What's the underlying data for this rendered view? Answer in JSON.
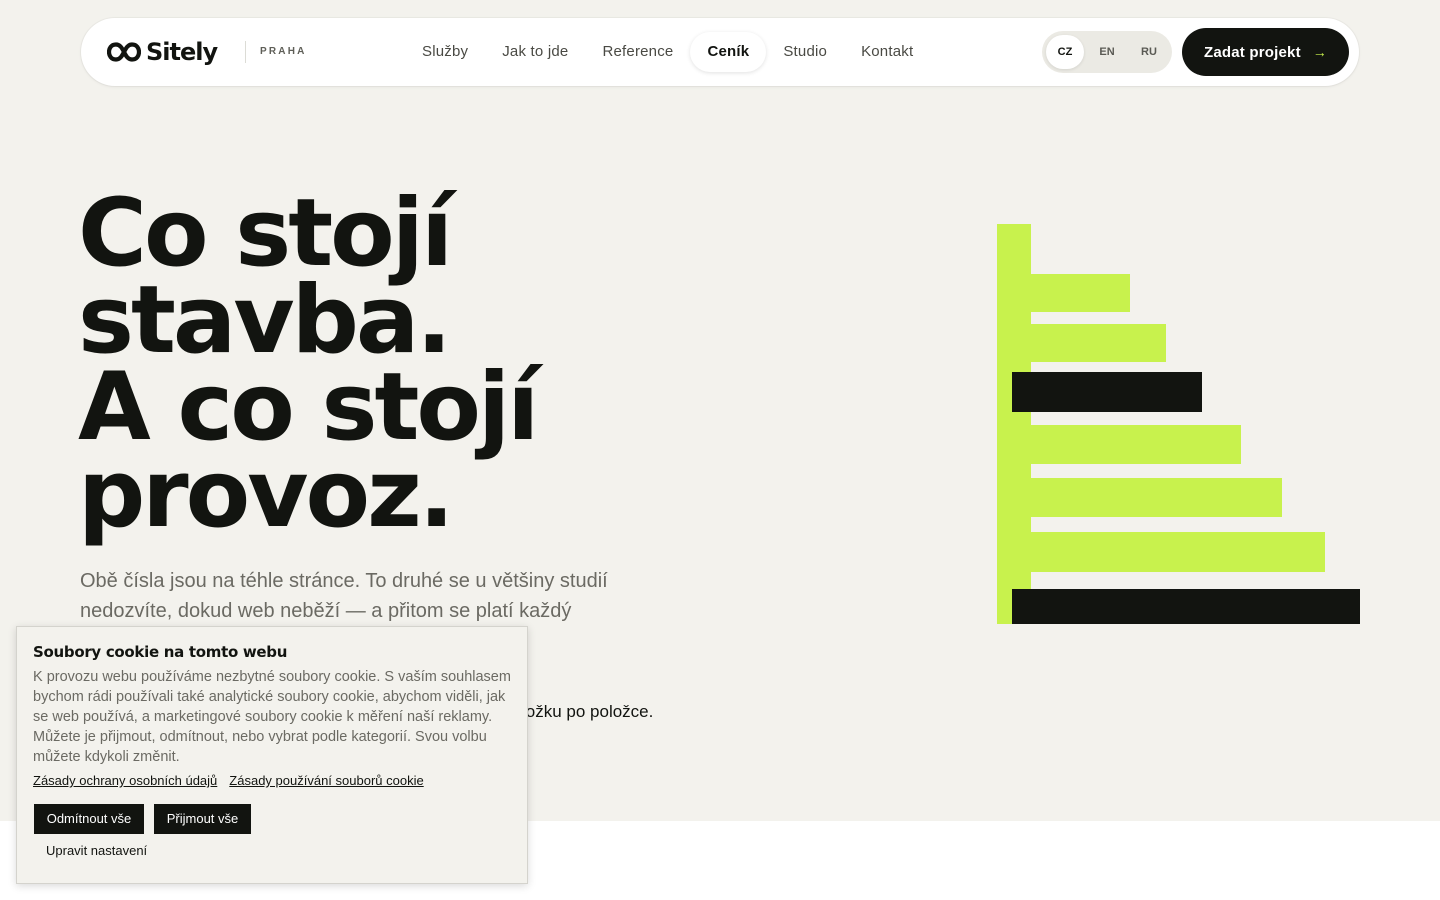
{
  "header": {
    "logo_text": "Sitely",
    "city": "PRAHA",
    "nav": [
      {
        "label": "Služby"
      },
      {
        "label": "Jak to jde"
      },
      {
        "label": "Reference"
      },
      {
        "label": "Ceník",
        "active": true
      },
      {
        "label": "Studio"
      },
      {
        "label": "Kontakt"
      }
    ],
    "languages": [
      "CZ",
      "EN",
      "RU"
    ],
    "active_language": "CZ",
    "cta_label": "Zadat projekt"
  },
  "hero": {
    "title_lines": [
      "Co stojí",
      "stavba.",
      "A co stojí",
      "provoz."
    ],
    "subtitle": "Obě čísla jsou na téhle stránce. To druhé se u většiny studií nedozvíte, dokud web neběží — a přitom se platí každý",
    "subtitle_tail": "ložku po položce."
  },
  "cookie": {
    "title": "Soubory cookie na tomto webu",
    "text": "K provozu webu používáme nezbytné soubory cookie. S vaším souhlasem bychom rádi používali také analytické soubory cookie, abychom viděli, jak se web používá, a marketingové soubory cookie k měření naší reklamy. Můžete je přijmout, odmítnout, nebo vybrat podle kategorií. Svou volbu můžete kdykoli změnit.",
    "privacy_link": "Zásady ochrany osobních údajů",
    "cookie_policy_link": "Zásady používání souborů cookie",
    "reject_label": "Odmítnout vše",
    "accept_label": "Přijmout vše",
    "settings_label": "Upravit nastavení"
  },
  "colors": {
    "accent": "#c8f24d",
    "dark": "#121410",
    "background": "#f3f2ed"
  },
  "icons": {
    "cta_arrow": "arrow-right-icon",
    "logo": "infinity-logo-icon"
  }
}
